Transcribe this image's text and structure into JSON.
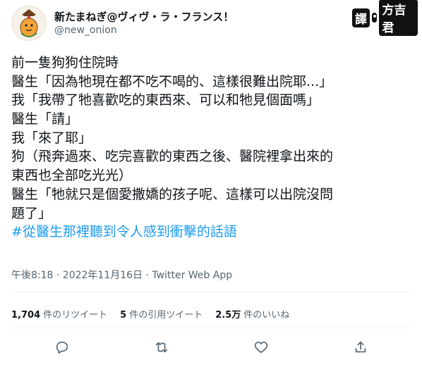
{
  "author": {
    "display_name": "新たまねぎ@ヴィヴ・ラ・フランス！",
    "handle": "@new_onion"
  },
  "badge": {
    "left": "譯",
    "right": "方吉君"
  },
  "tweet": {
    "lines": [
      "前一隻狗狗住院時",
      "醫生「因為牠現在都不吃不喝的、這樣很難出院耶...」",
      "我「我帶了牠喜歡吃的東西來、可以和牠見個面嗎」",
      "醫生「請」",
      "我「來了耶」",
      "狗（飛奔過來、吃完喜歡的東西之後、醫院裡拿出來的",
      "東西也全部吃光光）",
      "醫生「牠就只是個愛撒嬌的孩子呢、這樣可以出院沒問",
      "題了」"
    ],
    "hashtag": "#從醫生那裡聽到令人感到衝擊的話語"
  },
  "meta": {
    "time": "午後8:18 · 2022年11月16日 · Twitter Web App"
  },
  "stats": {
    "retweets_count": "1,704",
    "retweets_label": "件のリツイート",
    "quotes_count": "5",
    "quotes_label": "件の引用ツイート",
    "likes_count": "2.5万",
    "likes_label": "件のいいね"
  },
  "actions": {
    "reply": "reply-icon",
    "retweet": "retweet-icon",
    "like": "heart-icon",
    "share": "share-icon"
  }
}
